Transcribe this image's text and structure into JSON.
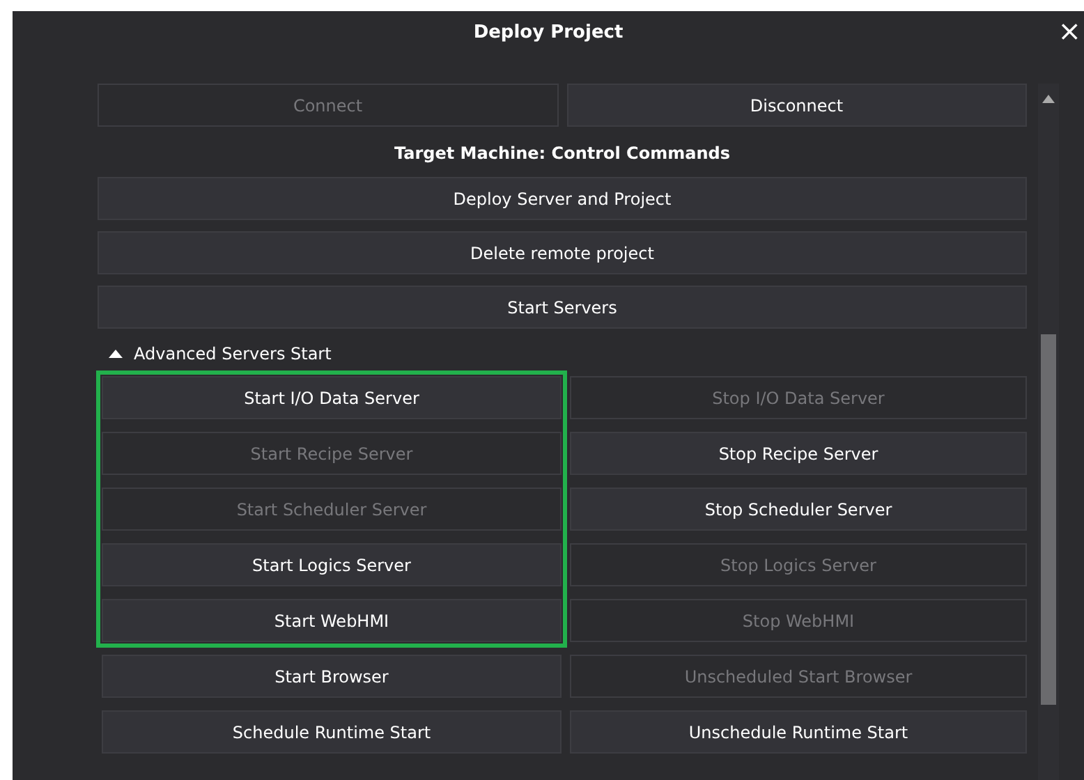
{
  "window": {
    "title": "Deploy Project",
    "close": "×"
  },
  "connection": [
    {
      "label": "Connect",
      "disabled": true
    },
    {
      "label": "Disconnect",
      "disabled": false
    }
  ],
  "heading": "Target Machine: Control Commands",
  "commands": [
    {
      "label": "Deploy Server and Project",
      "disabled": false
    },
    {
      "label": "Delete remote project",
      "disabled": false
    },
    {
      "label": "Start Servers",
      "disabled": false
    }
  ],
  "advanced": {
    "title": "Advanced Servers Start",
    "expanded": true,
    "highlighted_rows": [
      {
        "start": {
          "label": "Start I/O Data Server",
          "disabled": false
        },
        "stop": {
          "label": "Stop I/O Data Server",
          "disabled": true
        }
      },
      {
        "start": {
          "label": "Start Recipe Server",
          "disabled": true
        },
        "stop": {
          "label": "Stop Recipe Server",
          "disabled": false
        }
      },
      {
        "start": {
          "label": "Start Scheduler Server",
          "disabled": true
        },
        "stop": {
          "label": "Stop Scheduler Server",
          "disabled": false
        }
      },
      {
        "start": {
          "label": "Start Logics Server",
          "disabled": false
        },
        "stop": {
          "label": "Stop Logics Server",
          "disabled": true
        }
      },
      {
        "start": {
          "label": "Start WebHMI",
          "disabled": false
        },
        "stop": {
          "label": "Stop WebHMI",
          "disabled": true
        }
      }
    ],
    "rows": [
      {
        "start": {
          "label": "Start Browser",
          "disabled": false
        },
        "stop": {
          "label": "Unscheduled Start Browser",
          "disabled": true
        }
      },
      {
        "start": {
          "label": "Schedule Runtime Start",
          "disabled": false
        },
        "stop": {
          "label": "Unschedule Runtime Start",
          "disabled": false
        }
      }
    ]
  }
}
